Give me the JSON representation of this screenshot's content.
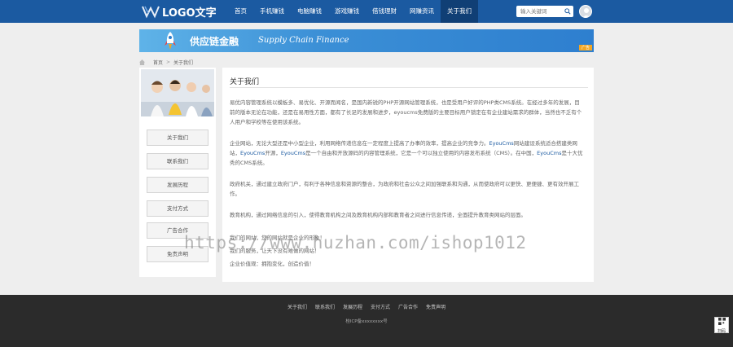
{
  "header": {
    "logo_text": "LOGO文字",
    "nav": [
      "首页",
      "手机赚钱",
      "电脑赚钱",
      "游戏赚钱",
      "借钱理财",
      "网赚资讯",
      "关于我们"
    ],
    "active_index": 6,
    "search_placeholder": "输入关键词",
    "brand_color": "#1b5aa1"
  },
  "banner": {
    "title": "供应链金融",
    "subtitle": "Supply Chain Finance",
    "tag": "广告"
  },
  "breadcrumb": {
    "home": "首页",
    "current": "关于我们"
  },
  "sidebar": {
    "items": [
      "关于我们",
      "联系我们",
      "发展历程",
      "支付方式",
      "广告合作",
      "免责声明"
    ]
  },
  "content": {
    "title": "关于我们",
    "p1": "易优内容管理系统以模板多、易优化、开源而闻名，是国内新锐的PHP开源网站管理系统，也是受用户好评的PHP类CMS系统。在经过多年的发展，目前的版本无论在功能，还是在易用性方面，都有了长足的发展和进步，eyoucms免费版的主要目标用户锁定在有企业建站需求的群体，当然也不乏有个人用户和学校等在使用该系统。",
    "p2_a": "企业网站，无论大型还是中小型企业，利用网络传递信息在一定程度上提高了办事的效率，提高企业的竞争力。",
    "p2_link1": "EyouCms",
    "p2_b": "网站建设系统适合搭建类网站，",
    "p2_link2": "EyouCms",
    "p2_c": "开源，",
    "p2_link3": "EyouCms",
    "p2_d": "是一个自由和开放源码的内容管理系统，它是一个可以独立使用的内容发布系统（CMS）。在中国，",
    "p2_link4": "EyouCms",
    "p2_e": "是十大优秀的CMS系统。",
    "p3": "政府机关，通过建立政府门户，有利于各种信息和资源的整合，为政府和社会公众之间加强联系和沟通，从而使政府可以更快、更便捷、更有效开展工作。",
    "p4": "教育机构，通过网络信息的引入，使得教育机构之间及教育机构内部和教育者之间进行信息传递，全面提升教育类网站的层面。",
    "p5_1": "我们的网站，您的网站就是企业的形象！",
    "p5_2": "我们的服务，让天下没有难做的网站！",
    "p5_3": "企业价值观：拥抱变化，创造价值！"
  },
  "footer": {
    "links": [
      "关于我们",
      "联系我们",
      "发展历程",
      "支付方式",
      "广告合作",
      "免责声明"
    ],
    "icp": "桂ICP备xxxxxxxx号"
  },
  "qr_label": "扫码",
  "watermark": "https://www.huzhan.com/ishop1012"
}
